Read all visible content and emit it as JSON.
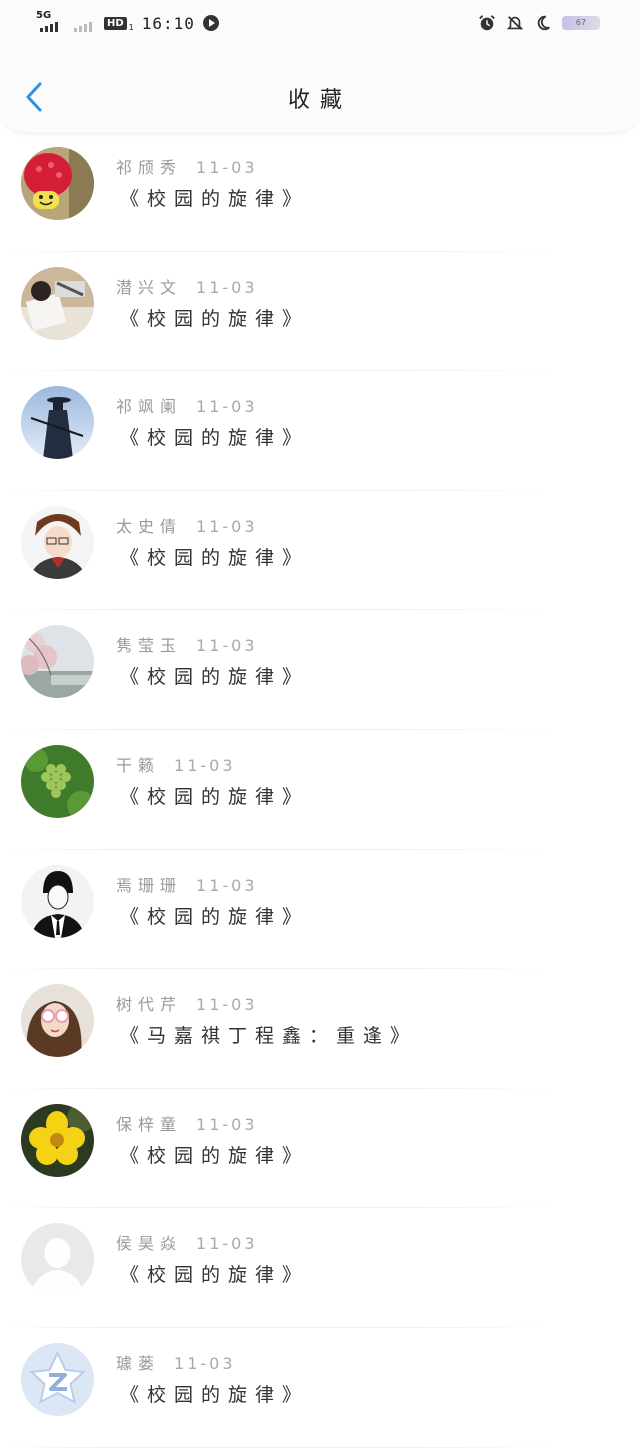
{
  "status_bar": {
    "network": "5G",
    "hd_badge": "HD",
    "hd_sub": "1",
    "time": "16:10",
    "battery": "67"
  },
  "header": {
    "title": "收藏"
  },
  "items": [
    {
      "name": "祁颀秀",
      "date": "11-03",
      "work": "《校园的旋律》"
    },
    {
      "name": "潜兴文",
      "date": "11-03",
      "work": "《校园的旋律》"
    },
    {
      "name": "祁飒阑",
      "date": "11-03",
      "work": "《校园的旋律》"
    },
    {
      "name": "太史倩",
      "date": "11-03",
      "work": "《校园的旋律》"
    },
    {
      "name": "隽莹玉",
      "date": "11-03",
      "work": "《校园的旋律》"
    },
    {
      "name": "干籁",
      "date": "11-03",
      "work": "《校园的旋律》"
    },
    {
      "name": "焉珊珊",
      "date": "11-03",
      "work": "《校园的旋律》"
    },
    {
      "name": "树代芹",
      "date": "11-03",
      "work": "《马嘉祺丁程鑫：重逢》"
    },
    {
      "name": "保梓童",
      "date": "11-03",
      "work": "《校园的旋律》"
    },
    {
      "name": "侯昊焱",
      "date": "11-03",
      "work": "《校园的旋律》"
    },
    {
      "name": "璩蒌",
      "date": "11-03",
      "work": "《校园的旋律》"
    }
  ]
}
